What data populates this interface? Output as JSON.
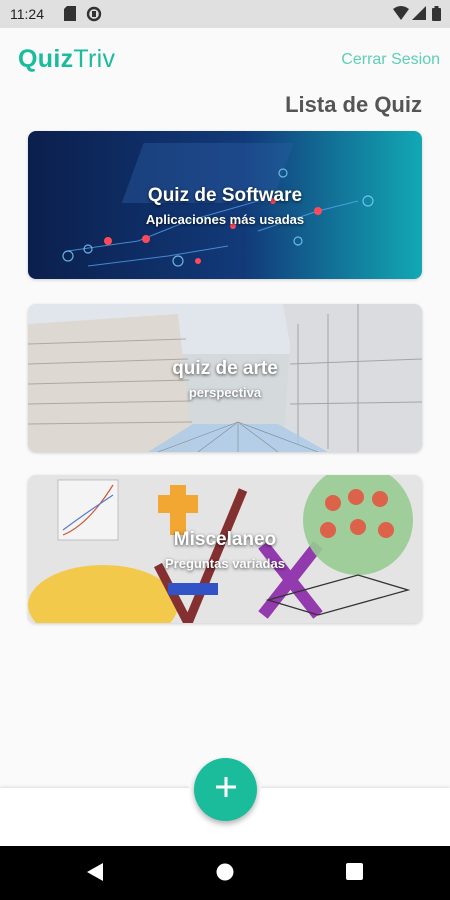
{
  "status_bar": {
    "time": "11:24",
    "icons": [
      "sd-card-icon",
      "sync-icon",
      "wifi-icon",
      "signal-icon",
      "battery-icon"
    ]
  },
  "header": {
    "logo_part1": "Quiz",
    "logo_part2": "Triv",
    "logout_label": "Cerrar Sesion"
  },
  "page_title": "Lista de Quiz",
  "quizzes": [
    {
      "title": "Quiz de Software",
      "subtitle": "Aplicaciones más usadas",
      "background": "circuit-tech-image"
    },
    {
      "title": "quiz de arte",
      "subtitle": "perspectiva",
      "background": "perspective-street-sketch-image"
    },
    {
      "title": "Miscelaneo",
      "subtitle": "Preguntas variadas",
      "background": "math-symbols-collage-image"
    }
  ],
  "fab": {
    "icon": "plus-icon"
  },
  "nav": {
    "back_icon": "back-triangle-icon",
    "home_icon": "home-circle-icon",
    "recents_icon": "recents-square-icon"
  },
  "colors": {
    "accent": "#1abc9c",
    "accent_light": "#5ccfb4",
    "title_gray": "#555555"
  }
}
